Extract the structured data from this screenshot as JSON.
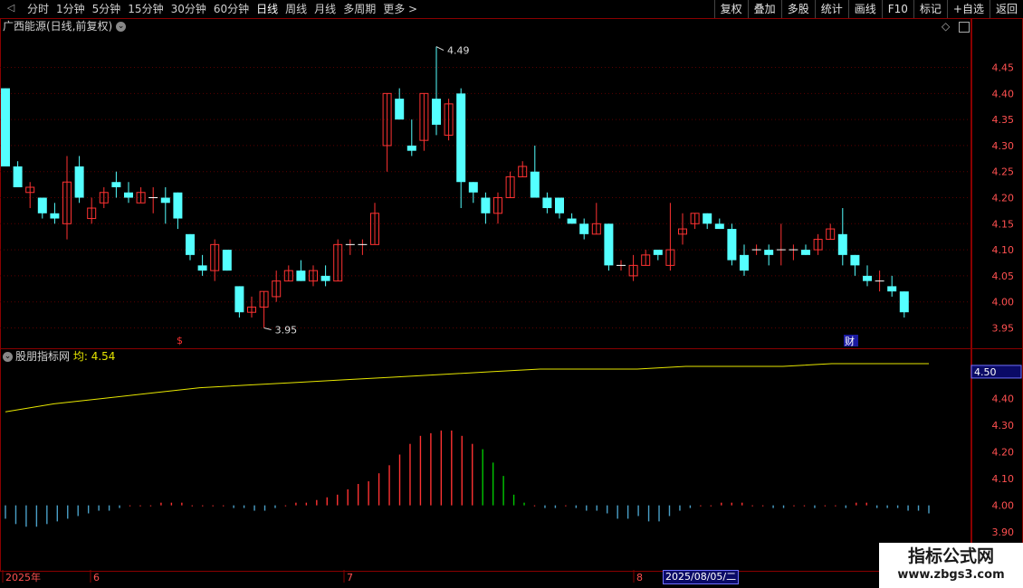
{
  "toolbar": {
    "periods": [
      "分时",
      "1分钟",
      "5分钟",
      "15分钟",
      "30分钟",
      "60分钟",
      "日线",
      "周线",
      "月线",
      "多周期",
      "更多 >"
    ],
    "active_period": "日线",
    "tools": [
      "复权",
      "叠加",
      "多股",
      "统计",
      "画线",
      "F10",
      "标记",
      "+自选",
      "返回"
    ]
  },
  "main_panel": {
    "stock_label": "广西能源(日线,前复权)",
    "high_marker": "4.49",
    "low_marker": "3.95",
    "y_ticks": [
      "4.45",
      "4.40",
      "4.35",
      "4.30",
      "4.25",
      "4.20",
      "4.15",
      "4.10",
      "4.05",
      "4.00",
      "3.95"
    ],
    "event_markers": [
      "$",
      "财"
    ]
  },
  "indicator_panel": {
    "name": "股朋指标网",
    "avg_label": "均: 4.54",
    "current_value_box": "4.50",
    "y_ticks": [
      "4.50",
      "4.40",
      "4.30",
      "4.20",
      "4.10",
      "4.00",
      "3.90"
    ]
  },
  "x_axis": {
    "labels": [
      "2025年",
      "6",
      "7",
      "8"
    ],
    "cursor_date": "2025/08/05/二"
  },
  "watermark": {
    "line1": "指标公式网",
    "line2": "www.zbgs3.com"
  },
  "colors": {
    "up": "#ff3232",
    "down": "#54ffff",
    "avg_line": "#e6e600",
    "grid": "#5a0000",
    "vol_down_green": "#00c800"
  },
  "chart_data": {
    "type": "candlestick",
    "ylim": [
      3.93,
      4.51
    ],
    "candles": [
      [
        4.41,
        4.26,
        4.41,
        4.26
      ],
      [
        4.26,
        4.22,
        4.27,
        4.22
      ],
      [
        4.21,
        4.22,
        4.18,
        4.23
      ],
      [
        4.2,
        4.17,
        4.16,
        4.2
      ],
      [
        4.17,
        4.16,
        4.15,
        4.19
      ],
      [
        4.15,
        4.23,
        4.12,
        4.28
      ],
      [
        4.26,
        4.2,
        4.19,
        4.28
      ],
      [
        4.16,
        4.18,
        4.15,
        4.2
      ],
      [
        4.19,
        4.21,
        4.18,
        4.22
      ],
      [
        4.23,
        4.22,
        4.2,
        4.25
      ],
      [
        4.21,
        4.2,
        4.19,
        4.23
      ],
      [
        4.19,
        4.21,
        4.19,
        4.22
      ],
      [
        4.2,
        4.2,
        4.17,
        4.22
      ],
      [
        4.2,
        4.19,
        4.15,
        4.22
      ],
      [
        4.21,
        4.16,
        4.14,
        4.21
      ],
      [
        4.13,
        4.09,
        4.08,
        4.13
      ],
      [
        4.07,
        4.06,
        4.05,
        4.09
      ],
      [
        4.06,
        4.11,
        4.04,
        4.12
      ],
      [
        4.1,
        4.06,
        4.06,
        4.1
      ],
      [
        4.03,
        3.98,
        3.97,
        4.03
      ],
      [
        3.98,
        3.99,
        3.97,
        4.01
      ],
      [
        3.99,
        4.02,
        3.95,
        4.02
      ],
      [
        4.01,
        4.04,
        4.0,
        4.06
      ],
      [
        4.04,
        4.06,
        4.04,
        4.07
      ],
      [
        4.06,
        4.04,
        4.04,
        4.08
      ],
      [
        4.04,
        4.06,
        4.03,
        4.07
      ],
      [
        4.05,
        4.04,
        4.03,
        4.07
      ],
      [
        4.04,
        4.11,
        4.04,
        4.12
      ],
      [
        4.11,
        4.11,
        4.09,
        4.12
      ],
      [
        4.11,
        4.11,
        4.09,
        4.12
      ],
      [
        4.11,
        4.17,
        4.11,
        4.19
      ],
      [
        4.3,
        4.4,
        4.25,
        4.4
      ],
      [
        4.39,
        4.35,
        4.35,
        4.41
      ],
      [
        4.3,
        4.29,
        4.28,
        4.35
      ],
      [
        4.31,
        4.4,
        4.29,
        4.4
      ],
      [
        4.39,
        4.34,
        4.32,
        4.49
      ],
      [
        4.32,
        4.38,
        4.31,
        4.39
      ],
      [
        4.4,
        4.23,
        4.18,
        4.41
      ],
      [
        4.23,
        4.21,
        4.19,
        4.23
      ],
      [
        4.2,
        4.17,
        4.15,
        4.21
      ],
      [
        4.17,
        4.2,
        4.15,
        4.21
      ],
      [
        4.2,
        4.24,
        4.2,
        4.25
      ],
      [
        4.24,
        4.26,
        4.24,
        4.27
      ],
      [
        4.25,
        4.2,
        4.2,
        4.3
      ],
      [
        4.2,
        4.18,
        4.17,
        4.21
      ],
      [
        4.2,
        4.17,
        4.16,
        4.2
      ],
      [
        4.16,
        4.15,
        4.15,
        4.17
      ],
      [
        4.15,
        4.13,
        4.12,
        4.16
      ],
      [
        4.13,
        4.15,
        4.13,
        4.19
      ],
      [
        4.15,
        4.07,
        4.06,
        4.15
      ],
      [
        4.07,
        4.07,
        4.06,
        4.08
      ],
      [
        4.05,
        4.07,
        4.04,
        4.09
      ],
      [
        4.07,
        4.09,
        4.07,
        4.1
      ],
      [
        4.1,
        4.09,
        4.08,
        4.1
      ],
      [
        4.07,
        4.1,
        4.06,
        4.19
      ],
      [
        4.13,
        4.14,
        4.11,
        4.17
      ],
      [
        4.15,
        4.17,
        4.14,
        4.17
      ],
      [
        4.17,
        4.15,
        4.14,
        4.17
      ],
      [
        4.15,
        4.14,
        4.14,
        4.16
      ],
      [
        4.14,
        4.08,
        4.07,
        4.15
      ],
      [
        4.09,
        4.06,
        4.05,
        4.11
      ],
      [
        4.1,
        4.1,
        4.09,
        4.11
      ],
      [
        4.1,
        4.09,
        4.07,
        4.11
      ],
      [
        4.1,
        4.1,
        4.07,
        4.15
      ],
      [
        4.1,
        4.1,
        4.08,
        4.11
      ],
      [
        4.1,
        4.09,
        4.09,
        4.11
      ],
      [
        4.1,
        4.12,
        4.09,
        4.13
      ],
      [
        4.12,
        4.14,
        4.12,
        4.15
      ],
      [
        4.13,
        4.09,
        4.07,
        4.18
      ],
      [
        4.09,
        4.07,
        4.05,
        4.09
      ],
      [
        4.05,
        4.04,
        4.03,
        4.07
      ],
      [
        4.04,
        4.04,
        4.02,
        4.06
      ],
      [
        4.03,
        4.02,
        4.01,
        4.05
      ],
      [
        4.02,
        3.98,
        3.97,
        4.02
      ]
    ],
    "avg_line": [
      4.35,
      4.38,
      4.4,
      4.42,
      4.44,
      4.45,
      4.46,
      4.47,
      4.48,
      4.49,
      4.5,
      4.51,
      4.51,
      4.51,
      4.52,
      4.52,
      4.52,
      4.53,
      4.53,
      4.53
    ],
    "osc_values": [
      -0.05,
      -0.07,
      -0.08,
      -0.08,
      -0.07,
      -0.06,
      -0.05,
      -0.04,
      -0.03,
      -0.02,
      -0.02,
      -0.01,
      0.0,
      0.0,
      0.0,
      0.01,
      0.01,
      0.01,
      0.0,
      0.0,
      0.0,
      0.0,
      -0.01,
      -0.01,
      -0.02,
      -0.02,
      -0.01,
      0.0,
      0.01,
      0.01,
      0.02,
      0.03,
      0.04,
      0.06,
      0.08,
      0.09,
      0.12,
      0.15,
      0.19,
      0.23,
      0.26,
      0.27,
      0.28,
      0.28,
      0.26,
      0.23,
      0.21,
      0.16,
      0.11,
      0.04,
      0.01,
      0.0,
      -0.01,
      -0.01,
      0.0,
      -0.01,
      -0.02,
      -0.02,
      -0.03,
      -0.05,
      -0.05,
      -0.04,
      -0.06,
      -0.06,
      -0.04,
      -0.02,
      -0.01,
      0.0,
      0.0,
      0.01,
      0.01,
      0.01,
      0.0,
      0.0,
      -0.01,
      -0.01,
      0.0,
      0.0,
      -0.01,
      0.0,
      0.0,
      -0.01,
      0.01,
      0.01,
      -0.01,
      -0.01,
      -0.01,
      -0.02,
      -0.02,
      -0.03
    ],
    "osc_ylim": [
      3.86,
      4.52
    ]
  }
}
